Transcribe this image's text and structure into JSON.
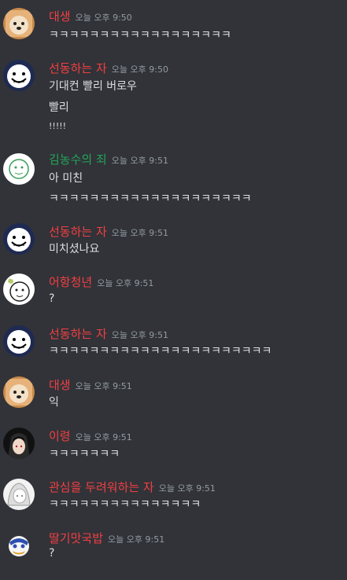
{
  "messages": [
    {
      "author": "대생",
      "time": "오늘 오후 9:50",
      "color": "#f23f43",
      "avatar": "dog-avatar",
      "lines": [
        "ㅋㅋㅋㅋㅋㅋㅋㅋㅋㅋㅋㅋㅋㅋㅋㅋㅋㅋ"
      ]
    },
    {
      "author": "선동하는 자",
      "time": "오늘 오후 9:50",
      "color": "#f23f43",
      "avatar": "cartoon-face-avatar",
      "lines": [
        "기대컨 빨리 버로우",
        "빨리",
        "!!!!!"
      ]
    },
    {
      "author": "김농수의 죄",
      "time": "오늘 오후 9:51",
      "color": "#23a55a",
      "avatar": "green-sketch-avatar",
      "lines": [
        "아 미친",
        "ㅋㅋㅋㅋㅋㅋㅋㅋㅋㅋㅋㅋㅋㅋㅋㅋㅋㅋㅋㅋ"
      ]
    },
    {
      "author": "선동하는 자",
      "time": "오늘 오후 9:51",
      "color": "#f23f43",
      "avatar": "cartoon-face-avatar",
      "lines": [
        "미치셨나요"
      ]
    },
    {
      "author": "어항청년",
      "time": "오늘 오후 9:51",
      "color": "#f23f43",
      "avatar": "doodle-avatar",
      "lines": [
        "?"
      ]
    },
    {
      "author": "선동하는 자",
      "time": "오늘 오후 9:51",
      "color": "#f23f43",
      "avatar": "cartoon-face-avatar",
      "lines": [
        "ㅋㅋㅋㅋㅋㅋㅋㅋㅋㅋㅋㅋㅋㅋㅋㅋㅋㅋㅋㅋㅋㅋ"
      ]
    },
    {
      "author": "대생",
      "time": "오늘 오후 9:51",
      "color": "#f23f43",
      "avatar": "dog-avatar",
      "lines": [
        "익"
      ]
    },
    {
      "author": "이령",
      "time": "오늘 오후 9:51",
      "color": "#f23f43",
      "avatar": "dark-hair-avatar",
      "lines": [
        "ㅋㅋㅋㅋㅋㅋㅋ"
      ]
    },
    {
      "author": "관심을 두려워하는 자",
      "time": "오늘 오후 9:51",
      "color": "#f23f43",
      "avatar": "white-hair-avatar",
      "lines": [
        "ㅋㅋㅋㅋㅋㅋㅋㅋㅋㅋㅋㅋㅋㅋㅋ"
      ]
    },
    {
      "author": "딸기맛국밥",
      "time": "오늘 오후 9:51",
      "color": "#f23f43",
      "avatar": "mascot-avatar",
      "lines": [
        "?"
      ]
    }
  ]
}
